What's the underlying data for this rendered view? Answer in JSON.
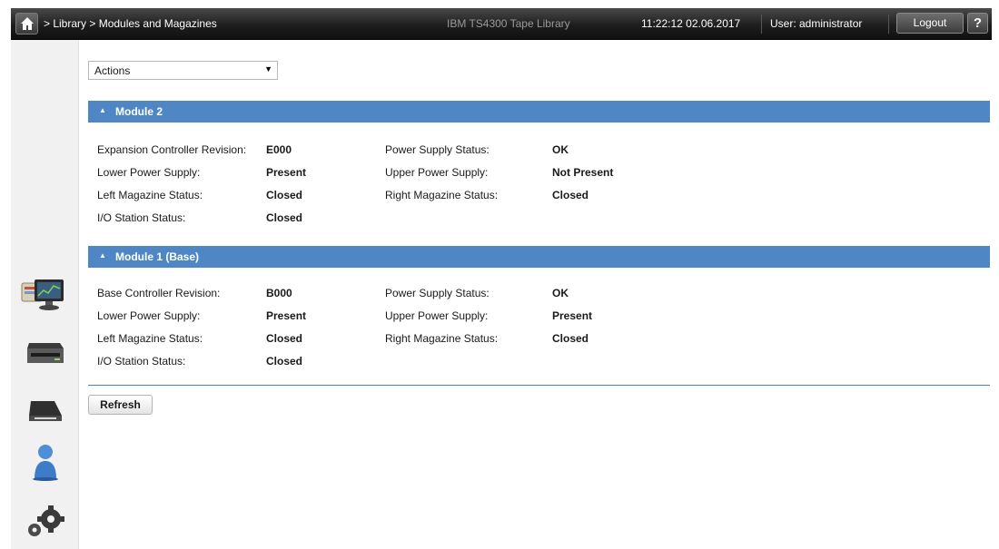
{
  "header": {
    "breadcrumb": "> Library > Modules and Magazines",
    "product": "IBM TS4300 Tape Library",
    "datetime": "11:22:12  02.06.2017",
    "user": "User: administrator",
    "logout_label": "Logout",
    "help_label": "?"
  },
  "nav": {
    "icons": [
      "monitoring-icon",
      "drive-icon",
      "cartridge-icon",
      "user-icon",
      "settings-gears-icon"
    ]
  },
  "actions": {
    "selected": "Actions"
  },
  "modules": [
    {
      "title": "Module  2",
      "fields": [
        {
          "label": "Expansion Controller Revision:",
          "value": "E000"
        },
        {
          "label": "Power Supply Status:",
          "value": "OK"
        },
        {
          "label": "Lower Power Supply:",
          "value": "Present"
        },
        {
          "label": "Upper Power Supply:",
          "value": "Not Present"
        },
        {
          "label": "Left Magazine Status:",
          "value": "Closed"
        },
        {
          "label": "Right Magazine Status:",
          "value": "Closed"
        },
        {
          "label": "I/O Station Status:",
          "value": "Closed"
        }
      ]
    },
    {
      "title": "Module  1  (Base)",
      "fields": [
        {
          "label": "Base Controller Revision:",
          "value": "B000"
        },
        {
          "label": "Power Supply Status:",
          "value": "OK"
        },
        {
          "label": "Lower Power Supply:",
          "value": "Present"
        },
        {
          "label": "Upper Power Supply:",
          "value": "Present"
        },
        {
          "label": "Left Magazine Status:",
          "value": "Closed"
        },
        {
          "label": "Right Magazine Status:",
          "value": "Closed"
        },
        {
          "label": "I/O Station Status:",
          "value": "Closed"
        }
      ]
    }
  ],
  "refresh_label": "Refresh",
  "colors": {
    "module_header": "#4f87c4",
    "topbar": "#1e1e1e"
  }
}
